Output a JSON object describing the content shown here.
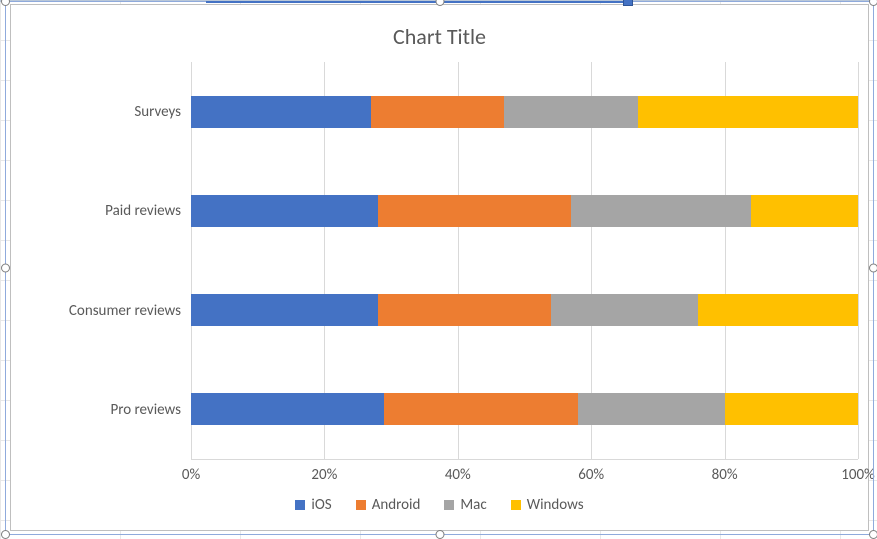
{
  "chart_data": {
    "type": "bar",
    "orientation": "horizontal-stacked-100",
    "title": "Chart Title",
    "xlabel": "",
    "ylabel": "",
    "xlim": [
      0,
      100
    ],
    "x_ticks": [
      "0%",
      "20%",
      "40%",
      "60%",
      "80%",
      "100%"
    ],
    "categories": [
      "Surveys",
      "Paid reviews",
      "Consumer reviews",
      "Pro reviews"
    ],
    "series": [
      {
        "name": "iOS",
        "color": "#4472c4",
        "values": [
          27,
          28,
          28,
          29
        ]
      },
      {
        "name": "Android",
        "color": "#ed7d31",
        "values": [
          20,
          29,
          26,
          29
        ]
      },
      {
        "name": "Mac",
        "color": "#a5a5a5",
        "values": [
          20,
          27,
          22,
          22
        ]
      },
      {
        "name": "Windows",
        "color": "#ffc000",
        "values": [
          33,
          16,
          24,
          20
        ]
      }
    ],
    "legend_position": "bottom",
    "grid": true
  },
  "ui": {
    "selection_handles": [
      "nw",
      "n",
      "ne",
      "w",
      "e",
      "sw",
      "s",
      "se"
    ]
  }
}
